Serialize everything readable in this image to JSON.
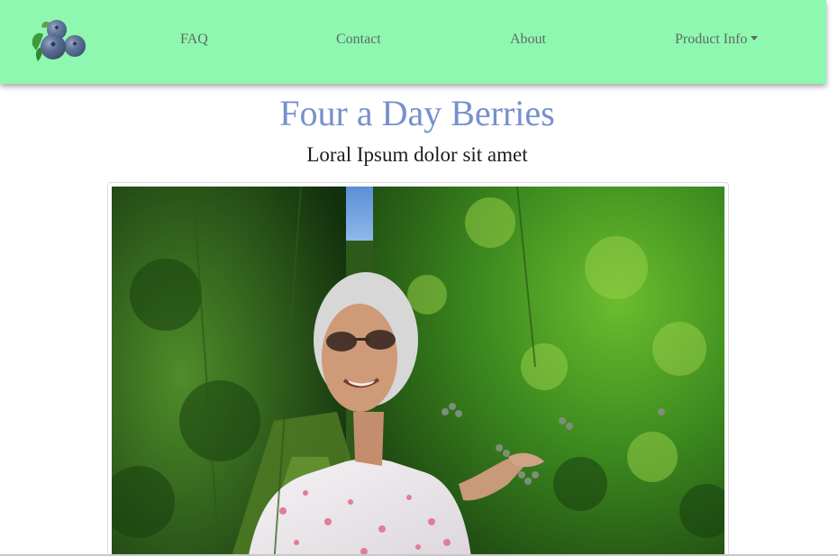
{
  "nav": {
    "logo_icon": "blueberries-logo-icon",
    "links": [
      {
        "label": "FAQ"
      },
      {
        "label": "Contact"
      },
      {
        "label": "About"
      },
      {
        "label": "Product Info",
        "dropdown": true
      }
    ]
  },
  "hero": {
    "title": "Four a Day Berries",
    "subtitle": "Loral Ipsum dolor sit amet",
    "photo_icon": "woman-in-blueberry-bushes-photo"
  },
  "colors": {
    "navbar_bg": "#8ff8b0",
    "nav_link": "#5d6b62",
    "title": "#7690cc"
  }
}
